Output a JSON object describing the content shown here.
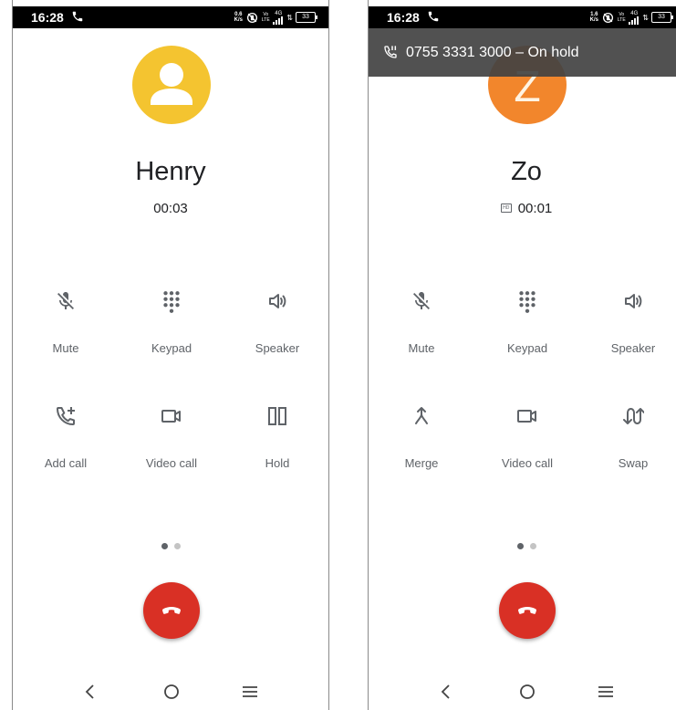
{
  "colors": {
    "status_bar": "#000000",
    "avatar_person": "#f4c430",
    "avatar_letter": "#f2862c",
    "end_call": "#d93025",
    "hold_banner": "#424242",
    "icon": "#5f6368",
    "dot_active": "#5f6368",
    "dot_inactive": "#c4c4c4"
  },
  "left": {
    "status_bar": {
      "time": "16:28",
      "net_speed_value": "0.6",
      "net_speed_unit": "K/s",
      "volte_top": "Vo",
      "volte_bottom": "LTE",
      "network": "4G",
      "battery": "33"
    },
    "avatar_icon": "person-icon",
    "contact": {
      "name": "Henry",
      "duration": "00:03"
    },
    "actions": [
      {
        "label": "Mute",
        "icon": "mic-off-icon"
      },
      {
        "label": "Keypad",
        "icon": "dialpad-icon"
      },
      {
        "label": "Speaker",
        "icon": "speaker-icon"
      },
      {
        "label": "Add call",
        "icon": "add-call-icon"
      },
      {
        "label": "Video call",
        "icon": "video-camera-icon"
      },
      {
        "label": "Hold",
        "icon": "pause-icon"
      }
    ]
  },
  "right": {
    "status_bar": {
      "time": "16:28",
      "net_speed_value": "1.6",
      "net_speed_unit": "K/s",
      "volte_top": "Vo",
      "volte_bottom": "LTE",
      "network": "4G",
      "battery": "33"
    },
    "hold_banner": {
      "text": "0755 3331 3000 – On hold",
      "icon": "phone-paused-icon"
    },
    "avatar_letter": "Z",
    "contact": {
      "name": "Zo",
      "duration": "00:01",
      "hd_badge": "HD"
    },
    "actions": [
      {
        "label": "Mute",
        "icon": "mic-off-icon"
      },
      {
        "label": "Keypad",
        "icon": "dialpad-icon"
      },
      {
        "label": "Speaker",
        "icon": "speaker-icon"
      },
      {
        "label": "Merge",
        "icon": "merge-icon"
      },
      {
        "label": "Video call",
        "icon": "video-camera-icon"
      },
      {
        "label": "Swap",
        "icon": "swap-calls-icon"
      }
    ]
  },
  "page_indicator": {
    "count": 2,
    "active": 1
  },
  "end_call_icon": "call-end-icon",
  "nav": [
    "back-icon",
    "home-icon",
    "recents-menu-icon"
  ]
}
